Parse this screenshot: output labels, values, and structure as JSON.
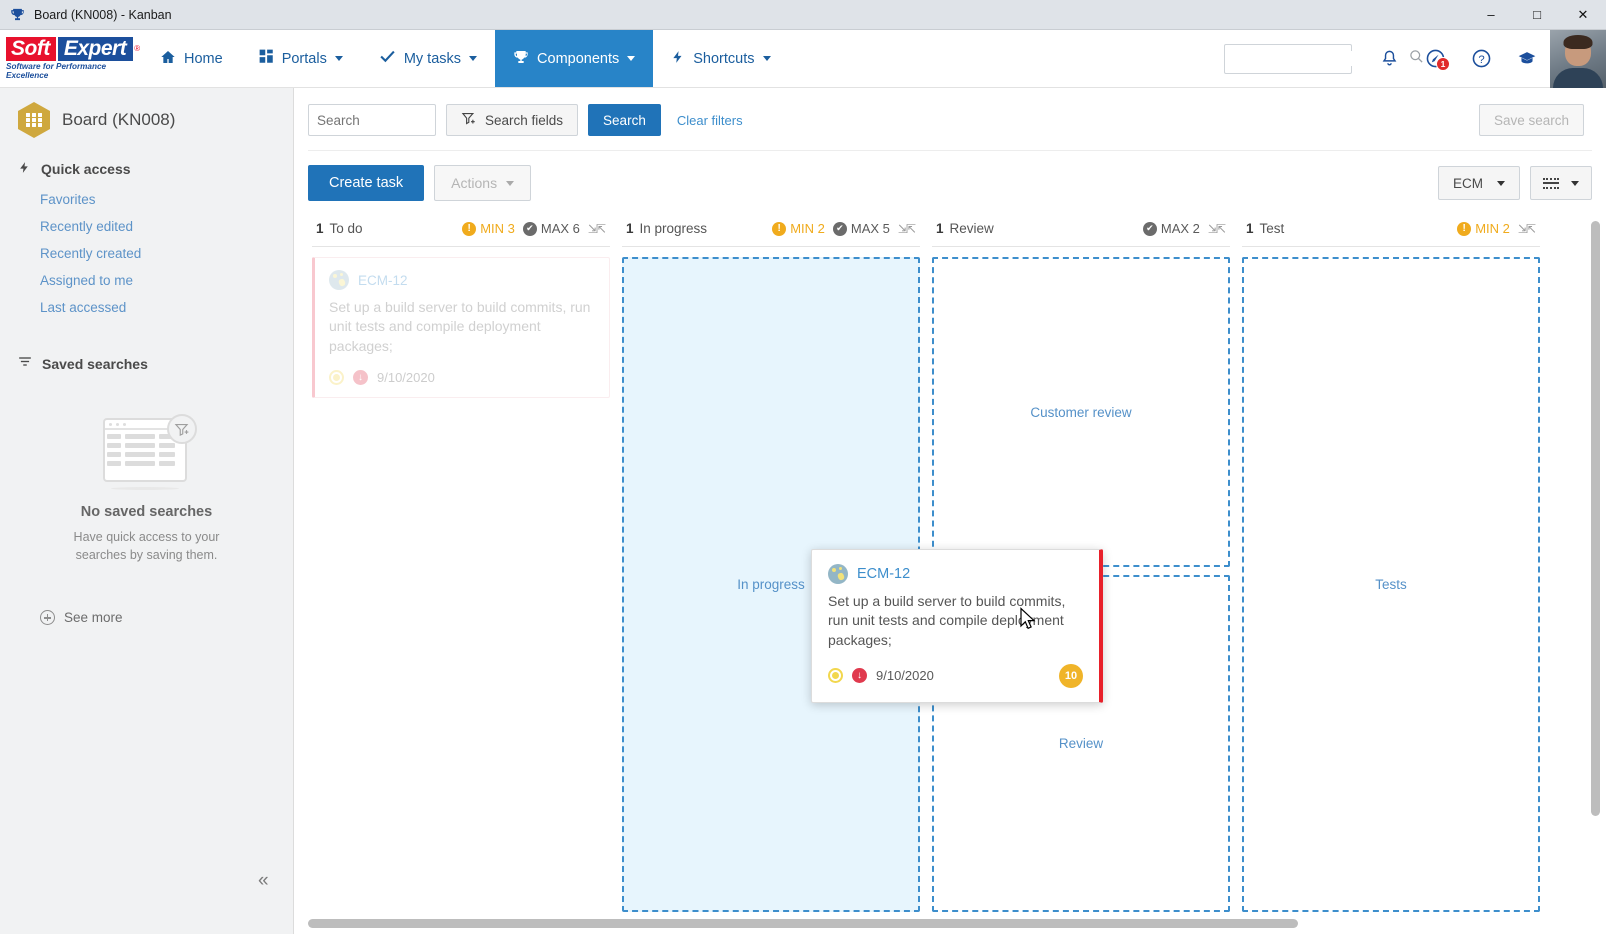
{
  "window": {
    "title": "Board (KN008) - Kanban",
    "icon": "trophy-icon",
    "minimize": "–",
    "maximize": "□",
    "close": "✕"
  },
  "brand": {
    "soft": "Soft",
    "expert": "Expert",
    "registered": "®",
    "tagline": "Software for Performance Excellence",
    "red": "#e8112d",
    "blue": "#1c4f9c"
  },
  "topnav": {
    "items": [
      {
        "label": "Home",
        "icon": "home-icon",
        "caret": false,
        "active": false
      },
      {
        "label": "Portals",
        "icon": "grid-icon",
        "caret": true,
        "active": false
      },
      {
        "label": "My tasks",
        "icon": "check-icon",
        "caret": true,
        "active": false
      },
      {
        "label": "Components",
        "icon": "trophy-icon",
        "caret": true,
        "active": true
      },
      {
        "label": "Shortcuts",
        "icon": "bolt-icon",
        "caret": true,
        "active": false
      }
    ],
    "search_placeholder": "",
    "search_value": "",
    "icons": [
      {
        "name": "search-icon"
      },
      {
        "name": "bell-icon"
      },
      {
        "name": "notification-icon",
        "badge": "1"
      },
      {
        "name": "help-icon"
      },
      {
        "name": "academy-icon"
      }
    ],
    "avatar": "user-avatar"
  },
  "sidebar": {
    "board_title": "Board (KN008)",
    "board_icon": "kanban-board-icon",
    "quick_access": {
      "label": "Quick access",
      "icon": "bolt-icon"
    },
    "quick_links": [
      "Favorites",
      "Recently edited",
      "Recently created",
      "Assigned to me",
      "Last accessed"
    ],
    "saved_searches": {
      "label": "Saved searches",
      "icon": "filter-icon"
    },
    "empty": {
      "title": "No saved searches",
      "subtitle": "Have quick access to your searches by saving them."
    },
    "see_more": "See more",
    "collapse_icon": "chevron-double-left-icon"
  },
  "filterbar": {
    "search_placeholder": "Search",
    "search_value": "",
    "search_fields_label": "Search fields",
    "search_button": "Search",
    "clear_filters": "Clear filters",
    "save_search": "Save search"
  },
  "actionbar": {
    "create_task": "Create task",
    "actions": "Actions",
    "view_scope": "ECM",
    "view_mode_icon": "list-view-icon"
  },
  "board": {
    "columns": [
      {
        "count": "1",
        "name": "To do",
        "min": "MIN 3",
        "max": "MAX 6",
        "dropzone_label": "",
        "dropzone_active": false,
        "has_card": true
      },
      {
        "count": "1",
        "name": "In progress",
        "min": "MIN 2",
        "max": "MAX 5",
        "dropzone_label": "In progress",
        "dropzone_active": true,
        "has_card": false
      },
      {
        "count": "1",
        "name": "Review",
        "min": "",
        "max": "MAX 2",
        "dropzone_label": "Customer review",
        "dropzone_label2": "Review",
        "dropzone_active": false,
        "has_card": false
      },
      {
        "count": "1",
        "name": "Test",
        "min": "MIN 2",
        "max": "",
        "dropzone_label": "Tests",
        "dropzone_active": false,
        "has_card": false
      }
    ],
    "ghost_card": {
      "id": "ECM-12",
      "title": "Set up a build server to build commits, run unit tests and compile deployment packages;",
      "due_date": "9/10/2020",
      "status_icon": "status-ring-icon",
      "due_icon": "overdue-icon"
    },
    "drag_card": {
      "id": "ECM-12",
      "title": "Set up a build server to build commits, run unit tests and compile deployment packages;",
      "due_date": "9/10/2020",
      "points": "10",
      "status_icon": "status-ring-icon",
      "due_icon": "overdue-icon"
    }
  },
  "colors": {
    "accent_blue": "#2073b8",
    "nav_active": "#2884c8",
    "link": "#3d8ecc",
    "warn_yellow": "#f0ab1d",
    "danger_red": "#e8202a",
    "dropzone_border": "#3d8ecc",
    "dropzone_fill": "#e7f5fd"
  }
}
